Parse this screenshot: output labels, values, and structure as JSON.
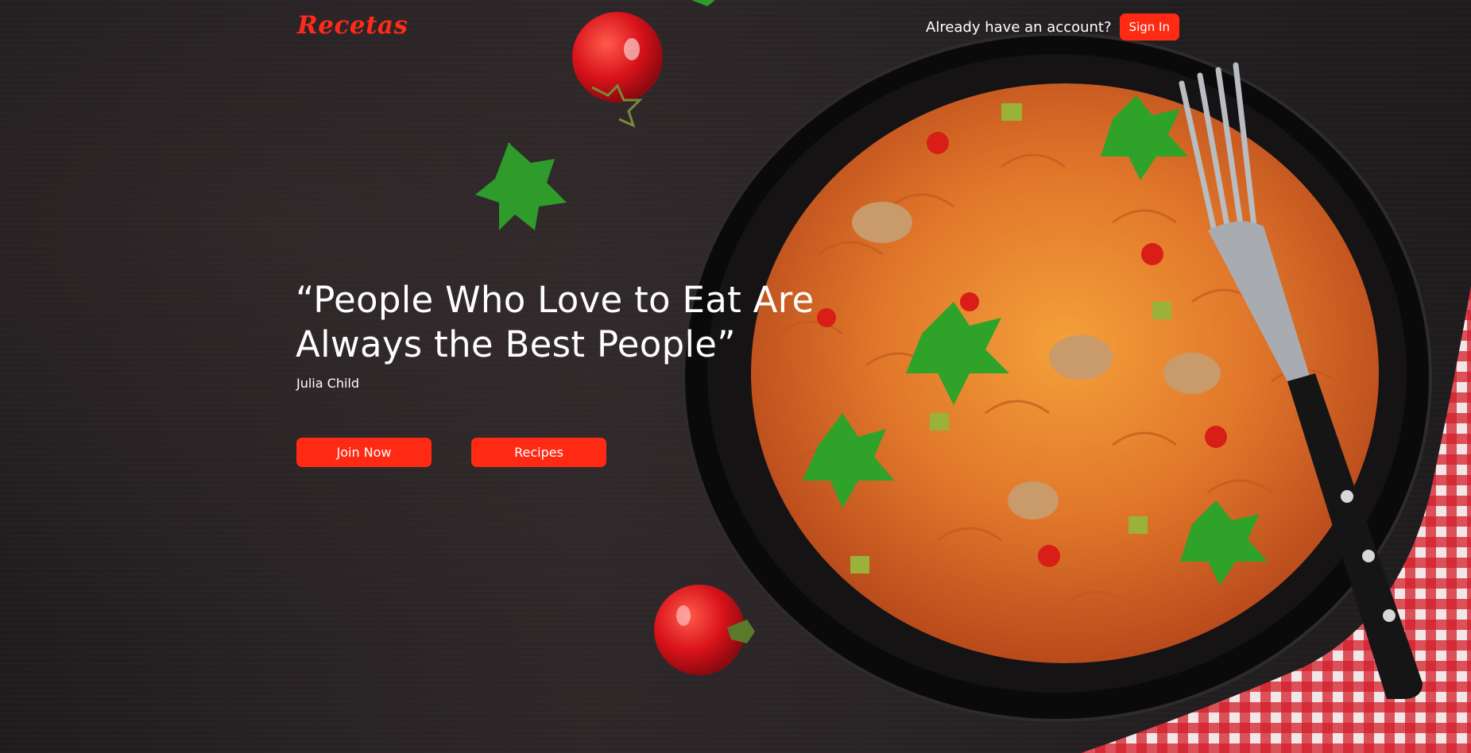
{
  "brand": {
    "logo_text": "Recetas",
    "accent_color": "#ff2a14"
  },
  "header": {
    "account_prompt": "Already have an account?",
    "sign_in_label": "Sign In"
  },
  "hero": {
    "quote_line_1": "“People Who Love to Eat Are",
    "quote_line_2": "Always the Best People”",
    "author": "Julia Child",
    "join_label": "Join Now",
    "recipes_label": "Recipes"
  }
}
